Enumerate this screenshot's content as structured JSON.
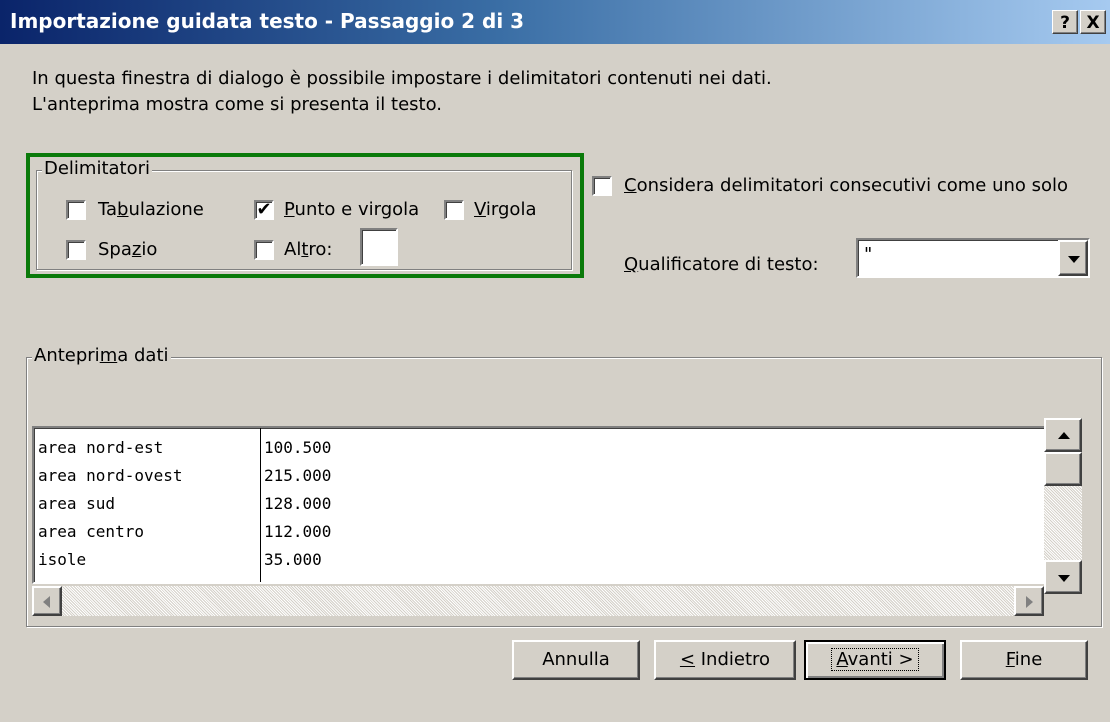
{
  "window": {
    "title": "Importazione guidata testo - Passaggio 2 di 3",
    "help_label": "?",
    "close_label": "X"
  },
  "intro": {
    "line1": "In questa finestra di dialogo è possibile impostare i delimitatori contenuti nei dati.",
    "line2": "L'anteprima mostra come si presenta il testo."
  },
  "delimiters": {
    "label": "Delimitatori",
    "tab": {
      "pre": "Ta",
      "key": "b",
      "post": "ulazione",
      "checked": false
    },
    "semicolon": {
      "pre": "",
      "key": "P",
      "post": "unto e virgola",
      "checked": true
    },
    "comma": {
      "pre": "",
      "key": "V",
      "post": "irgola",
      "checked": false
    },
    "space": {
      "pre": "Spa",
      "key": "z",
      "post": "io",
      "checked": false
    },
    "other": {
      "pre": "Al",
      "key": "t",
      "post": "ro:",
      "checked": false,
      "value": ""
    },
    "check_mark": "✔"
  },
  "consecutive": {
    "pre": "",
    "key": "C",
    "post": "onsidera delimitatori consecutivi come uno solo",
    "checked": false
  },
  "qualifier": {
    "pre": "",
    "key": "Q",
    "post": "ualificatore di testo:",
    "value": "\""
  },
  "preview": {
    "label_pre": "Antepri",
    "label_key": "m",
    "label_post": "a dati",
    "rows": [
      {
        "col1": "area nord-est",
        "col2": "100.500"
      },
      {
        "col1": "area nord-ovest",
        "col2": "215.000"
      },
      {
        "col1": "area sud",
        "col2": "128.000"
      },
      {
        "col1": "area centro",
        "col2": "112.000"
      },
      {
        "col1": "isole",
        "col2": "35.000"
      }
    ]
  },
  "buttons": {
    "cancel": "Annulla",
    "back_key": "<",
    "back_post": " Indietro",
    "next_key": "A",
    "next_post": "vanti >",
    "finish_key": "F",
    "finish_post": "ine"
  },
  "colors": {
    "highlight_border": "#0a7a0a",
    "titlebar_start": "#0a246a",
    "titlebar_end": "#a6caf0"
  }
}
